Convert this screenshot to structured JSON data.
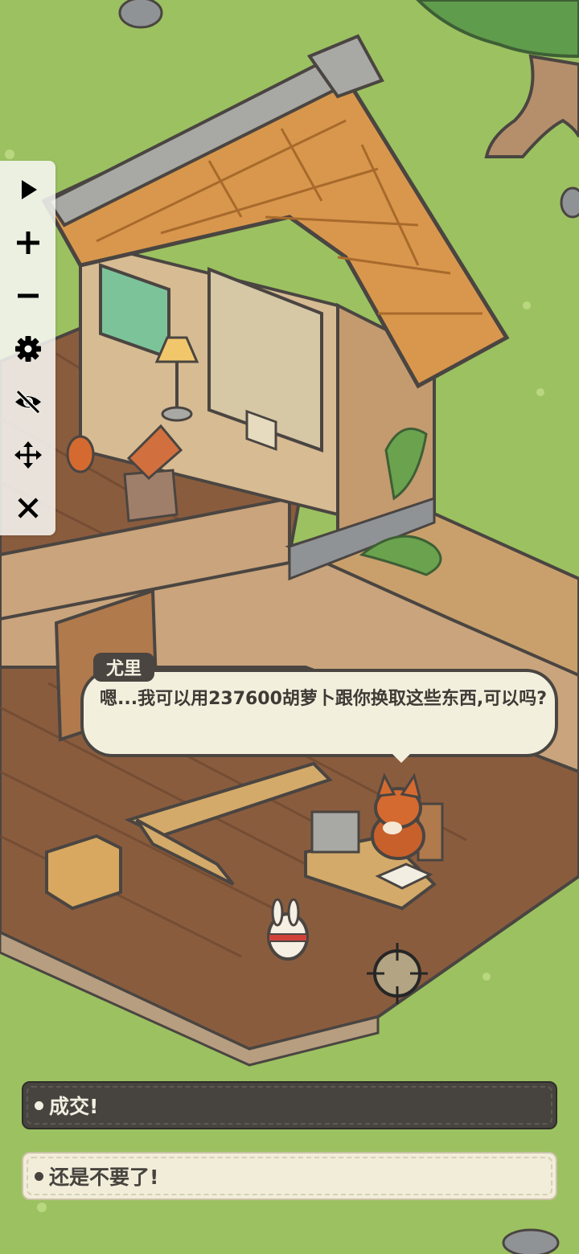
{
  "toolbar": {
    "items": [
      {
        "icon": "play-icon"
      },
      {
        "icon": "plus-icon"
      },
      {
        "icon": "minus-icon"
      },
      {
        "icon": "gear-icon"
      },
      {
        "icon": "eye-slash-icon"
      },
      {
        "icon": "move-icon"
      },
      {
        "icon": "close-icon"
      }
    ]
  },
  "dialogue": {
    "speaker": "尤里",
    "text": "嗯...我可以用237600胡萝卜跟你换取这些东西,可以吗?"
  },
  "choices": {
    "accept": "成交!",
    "decline": "还是不要了!"
  },
  "colors": {
    "grass": "#9cc161",
    "bubble": "#f3efdd",
    "ink": "#4a4541",
    "choice_dark": "#47443f",
    "choice_light": "#f1edd9"
  }
}
